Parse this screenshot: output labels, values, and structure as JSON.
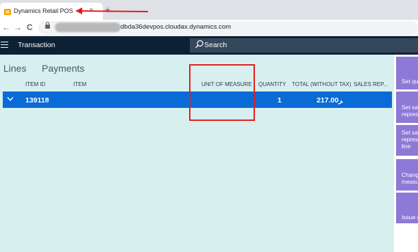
{
  "browser": {
    "tab_title": "Dynamics Retail POS",
    "close_glyph": "×",
    "new_tab_glyph": "+",
    "back_glyph": "←",
    "forward_glyph": "→",
    "reload_glyph": "C",
    "url": "dbda36devpos.cloudax.dynamics.com"
  },
  "app": {
    "title": "Transaction",
    "search_placeholder": "Search"
  },
  "pivot": {
    "tabs": [
      "Lines",
      "Payments"
    ],
    "selected": "Lines"
  },
  "table": {
    "columns": [
      "ITEM ID",
      "ITEM",
      "UNIT OF MEASURE",
      "QUANTITY",
      "TOTAL (WITHOUT TAX)",
      "SALES REP..."
    ],
    "rows": [
      {
        "item_id": "139118",
        "item": "",
        "unit_of_measure": "",
        "quantity": "1",
        "total": "217.00ﺮ"
      }
    ]
  },
  "actions": [
    "Set qu",
    "Set sal",
    "repres",
    "Set sal",
    "repres",
    "line",
    "Chang",
    "measu",
    "Issue c"
  ],
  "colors": {
    "app_bar": "#0d2136",
    "content_bg": "#d8efef",
    "selected_row": "#0b6bd6",
    "action_button": "#8d7ad6",
    "annotation_red": "#e21c1c"
  },
  "icons": [
    "office-favicon-icon",
    "close-icon",
    "plus-icon",
    "back-arrow-icon",
    "forward-arrow-icon",
    "reload-icon",
    "lock-icon",
    "hamburger-icon",
    "search-icon",
    "chevron-down-icon"
  ]
}
